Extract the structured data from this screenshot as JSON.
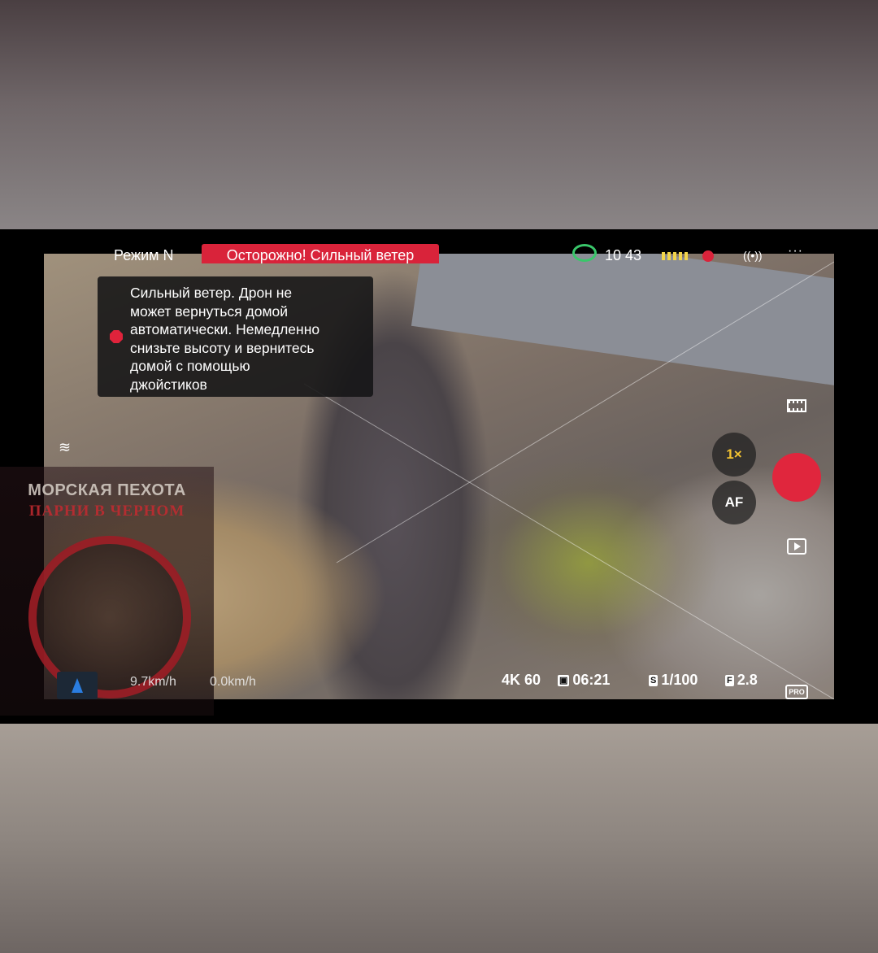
{
  "status_bar": {
    "mode": "Режим N",
    "warning": "Осторожно! Сильный ветер",
    "time": "10 43",
    "more": "···"
  },
  "alert": {
    "message": "Сильный ветер. Дрон не\nможет вернуться домой\nавтоматически. Немедленно\nснизьте высоту и вернитесь\nдомой с помощью\nджойстиков"
  },
  "camera": {
    "zoom": "1×",
    "focus_mode": "AF",
    "resolution": "4K 60",
    "record_time": "06:21",
    "shutter_badge": "S",
    "shutter": "1/100",
    "aperture_badge": "F",
    "aperture": "2.8",
    "pro_label": "PRO"
  },
  "telemetry": {
    "horizontal_speed": "9.7km/h",
    "vertical_speed": "0.0km/h"
  },
  "watermark": {
    "line1": "МОРСКАЯ ПЕХОТА",
    "line2": "ПАРНИ В ЧЕРНОМ"
  },
  "colors": {
    "warning_red": "#d9233a",
    "record_red": "#e0263d",
    "zoom_yellow": "#f2c230",
    "battery_green": "#39c66a"
  }
}
